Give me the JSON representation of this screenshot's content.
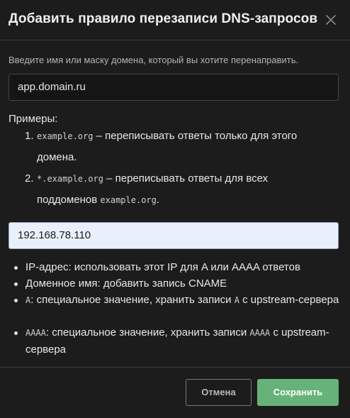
{
  "dialog": {
    "title": "Добавить правило перезаписи DNS-запросов",
    "description": "Введите имя или маску домена, который вы хотите перенаправить.",
    "domain_value": "app.domain.ru",
    "examples_title": "Примеры:",
    "examples": [
      {
        "num": "1.",
        "code": "example.org",
        "text": " – переписывать ответы только для этого",
        "text2": "домена."
      },
      {
        "num": "2.",
        "code": "*.example.org",
        "text": " – переписывать ответы для всех",
        "text2_pre": "поддоменов ",
        "code2": "example.org",
        "text2_post": "."
      }
    ],
    "answer_value": "192.168.78.110",
    "hints": [
      {
        "text": "IP-адрес: использовать этот IP для A или AAAA ответов"
      },
      {
        "text": "Доменное имя: добавить запись CNAME"
      },
      {
        "code": "A",
        "text": ": специальное значение, хранить записи ",
        "code2": "A",
        "text_post": " с upstream-сервера"
      },
      {
        "code": "AAAA",
        "text": ": специальное значение, хранить записи ",
        "code2": "AAAA",
        "text_post": " с upstream-сервера"
      }
    ],
    "cancel_label": "Отмена",
    "save_label": "Сохранить"
  },
  "colors": {
    "background": "#1c1c1c",
    "save_button": "#67b279",
    "answer_field_bg": "#e8f0fe"
  }
}
